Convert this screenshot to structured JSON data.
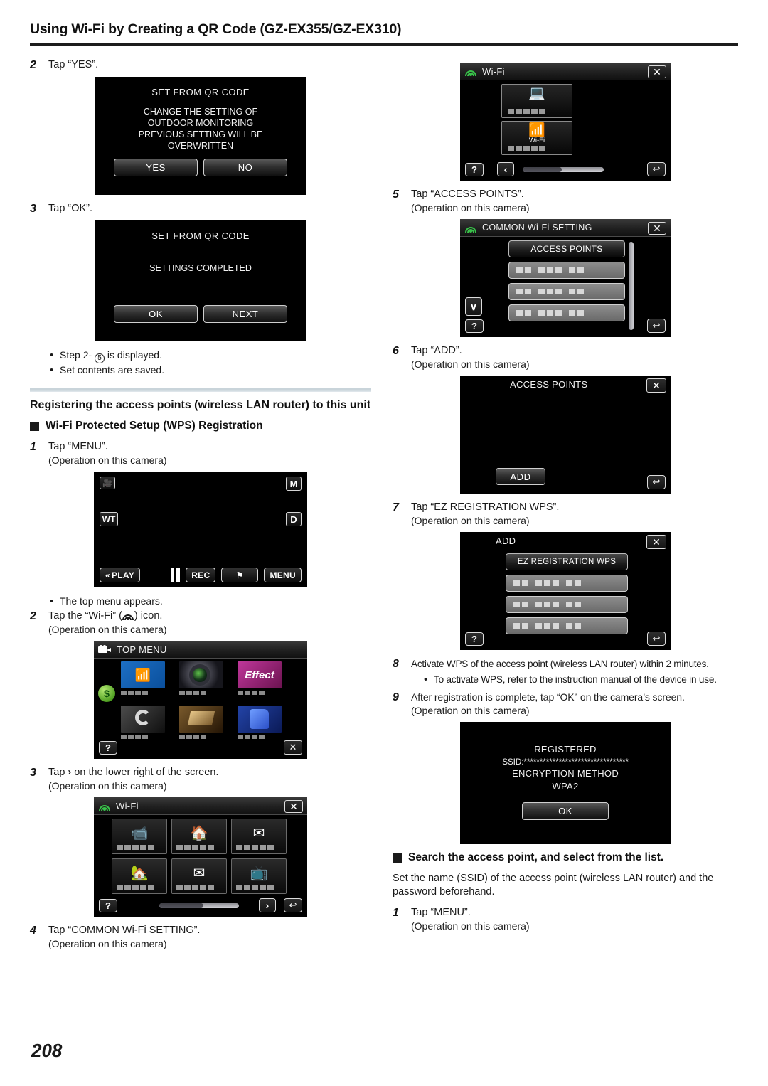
{
  "header": {
    "title": "Using Wi-Fi by Creating a QR Code (GZ-EX355/GZ-EX310)"
  },
  "page_number": "208",
  "left_column": {
    "step2": {
      "num": "2",
      "text": "Tap “YES”."
    },
    "screen_qr_confirm": {
      "title": "SET FROM QR CODE",
      "message_lines": [
        "CHANGE THE SETTING OF",
        "OUTDOOR MONITORING",
        "PREVIOUS SETTING WILL BE",
        "OVERWRITTEN"
      ],
      "yes_label": "YES",
      "no_label": "NO"
    },
    "step3": {
      "num": "3",
      "text": "Tap “OK”."
    },
    "screen_qr_complete": {
      "title": "SET FROM QR CODE",
      "message": "SETTINGS COMPLETED",
      "ok_label": "OK",
      "next_label": "NEXT"
    },
    "notes": [
      {
        "prefix": "Step 2-",
        "circled": "5",
        "suffix": " is displayed."
      },
      {
        "prefix": "Set contents are saved.",
        "circled": "",
        "suffix": ""
      }
    ],
    "section_title": "Registering the access points (wireless LAN router) to this unit",
    "sub_head": "Wi-Fi Protected Setup (WPS) Registration",
    "step_menu": {
      "num": "1",
      "text": "Tap “MENU”.",
      "sub": "(Operation on this camera)"
    },
    "screen_rec": {
      "movie_icon": "movie-camera-icon",
      "m_label": "M",
      "wt_label": "WT",
      "d_label": "D",
      "play_label": "PLAY",
      "rec_label": "REC",
      "menu_label": "MENU"
    },
    "note_top_menu": "The top menu appears.",
    "step_wifi_icon": {
      "num": "2",
      "text_before": "Tap the “Wi-Fi” (",
      "text_after": ") icon.",
      "sub": "(Operation on this camera)"
    },
    "screen_top_menu": {
      "title": "TOP MENU",
      "tiles": [
        {
          "name": "wifi-tile"
        },
        {
          "name": "recording-settings-tile"
        },
        {
          "name": "special-recording-tile"
        },
        {
          "name": "playback-settings-tile"
        },
        {
          "name": "media-settings-tile"
        },
        {
          "name": "connection-settings-tile"
        }
      ],
      "help_label": "?",
      "close_label": "✕",
      "badge": "$"
    },
    "step_arrow": {
      "num": "3",
      "text_before": "Tap ",
      "arrow": "›",
      "text_after": " on the lower right of the screen.",
      "sub": "(Operation on this camera)"
    },
    "screen_wifi_menu": {
      "title": "Wi-Fi",
      "tiles": [
        {
          "name": "direct-monitoring-tile"
        },
        {
          "name": "indoor-monitoring-tile"
        },
        {
          "name": "video-mail-tile"
        },
        {
          "name": "outdoor-monitoring-tile"
        },
        {
          "name": "detect-mail-tile"
        },
        {
          "name": "tv-monitoring-tile"
        }
      ],
      "help_label": "?",
      "next_label": "›",
      "back_label": "↩",
      "close_label": "✕"
    },
    "step_common": {
      "num": "4",
      "text": "Tap “COMMON Wi-Fi SETTING”.",
      "sub": "(Operation on this camera)"
    }
  },
  "right_column": {
    "screen_wifi_page2": {
      "title": "Wi-Fi",
      "tiles": [
        {
          "name": "direct-monitoring-tile",
          "label": ""
        },
        {
          "name": "common-wifi-setting-tile",
          "label": "Wi-Fi"
        }
      ],
      "help_label": "?",
      "prev_label": "‹",
      "back_label": "↩",
      "close_label": "✕"
    },
    "step5": {
      "num": "5",
      "text": "Tap “ACCESS POINTS”.",
      "sub": "(Operation on this camera)"
    },
    "screen_common_setting": {
      "title": "COMMON Wi-Fi SETTING",
      "selected_row": "ACCESS POINTS",
      "blank_rows": 3,
      "help_label": "?",
      "down_label": "∨",
      "back_label": "↩",
      "close_label": "✕"
    },
    "step6": {
      "num": "6",
      "text": "Tap “ADD”.",
      "sub": "(Operation on this camera)"
    },
    "screen_access_points": {
      "title": "ACCESS POINTS",
      "add_label": "ADD",
      "back_label": "↩",
      "close_label": "✕"
    },
    "step7": {
      "num": "7",
      "text": "Tap “EZ REGISTRATION WPS”.",
      "sub": "(Operation on this camera)"
    },
    "screen_add": {
      "title": "ADD",
      "selected_row": "EZ REGISTRATION WPS",
      "blank_rows": 3,
      "help_label": "?",
      "back_label": "↩",
      "close_label": "✕"
    },
    "step8": {
      "num": "8",
      "text": "Activate WPS of the access point (wireless LAN router) within 2 minutes.",
      "note": "To activate WPS, refer to the instruction manual of the device in use."
    },
    "step9": {
      "num": "9",
      "text": "After registration is complete, tap “OK” on the camera’s screen.",
      "sub": "(Operation on this camera)"
    },
    "screen_registered": {
      "title": "REGISTERED",
      "ssid_label": "SSID:",
      "ssid_value": "*********************************",
      "encryption_label": "ENCRYPTION METHOD",
      "encryption_value": "WPA2",
      "ok_label": "OK"
    },
    "sub_head_search": "Search the access point, and select from the list.",
    "search_body": "Set the name (SSID) of the access point (wireless LAN router) and the password beforehand.",
    "step_search_menu": {
      "num": "1",
      "text": "Tap “MENU”.",
      "sub": "(Operation on this camera)"
    }
  }
}
